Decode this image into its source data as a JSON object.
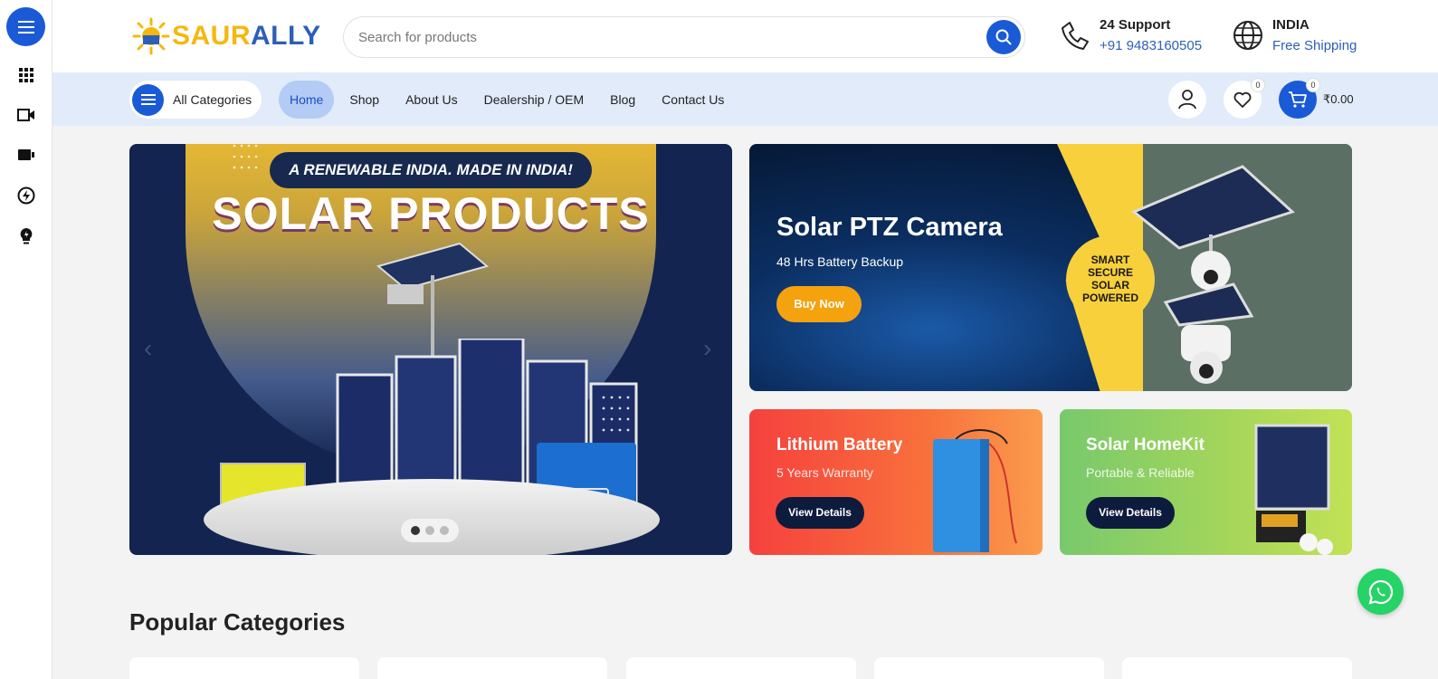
{
  "brand": {
    "logo_saur": "SAUR",
    "logo_ally": "ALLY",
    "primary_color": "#1a5ad6",
    "accent_color": "#f5b80f"
  },
  "rail": {
    "icons": [
      "menu-icon",
      "grid-icon",
      "video-icon",
      "camera-icon",
      "bolt-icon",
      "bulb-icon"
    ]
  },
  "search": {
    "placeholder": "Search for products"
  },
  "support": {
    "title": "24 Support",
    "phone": "+91 9483160505"
  },
  "region": {
    "title": "INDIA",
    "sub": "Free Shipping"
  },
  "nav": {
    "all_categories": "All Categories",
    "items": [
      {
        "label": "Home",
        "active": true
      },
      {
        "label": "Shop",
        "active": false
      },
      {
        "label": "About Us",
        "active": false
      },
      {
        "label": "Dealership / OEM",
        "active": false
      },
      {
        "label": "Blog",
        "active": false
      },
      {
        "label": "Contact Us",
        "active": false
      }
    ],
    "wishlist_count": "0",
    "cart_count": "0",
    "cart_total": "₹0.00"
  },
  "hero": {
    "tagline": "A RENEWABLE INDIA. MADE IN INDIA!",
    "title": "SOLAR PRODUCTS",
    "slides": 3,
    "active_slide": 1
  },
  "promos": {
    "camera": {
      "title": "Solar PTZ Camera",
      "subtitle": "48 Hrs Battery Backup",
      "button": "Buy Now",
      "badge_lines": [
        "SMART",
        "SECURE",
        "SOLAR",
        "POWERED"
      ]
    },
    "lithium": {
      "title": "Lithium Battery",
      "subtitle": "5 Years Warranty",
      "button": "View Details"
    },
    "homekit": {
      "title": "Solar HomeKit",
      "subtitle": "Portable & Reliable",
      "button": "View Details"
    }
  },
  "popular": {
    "title": "Popular Categories"
  }
}
